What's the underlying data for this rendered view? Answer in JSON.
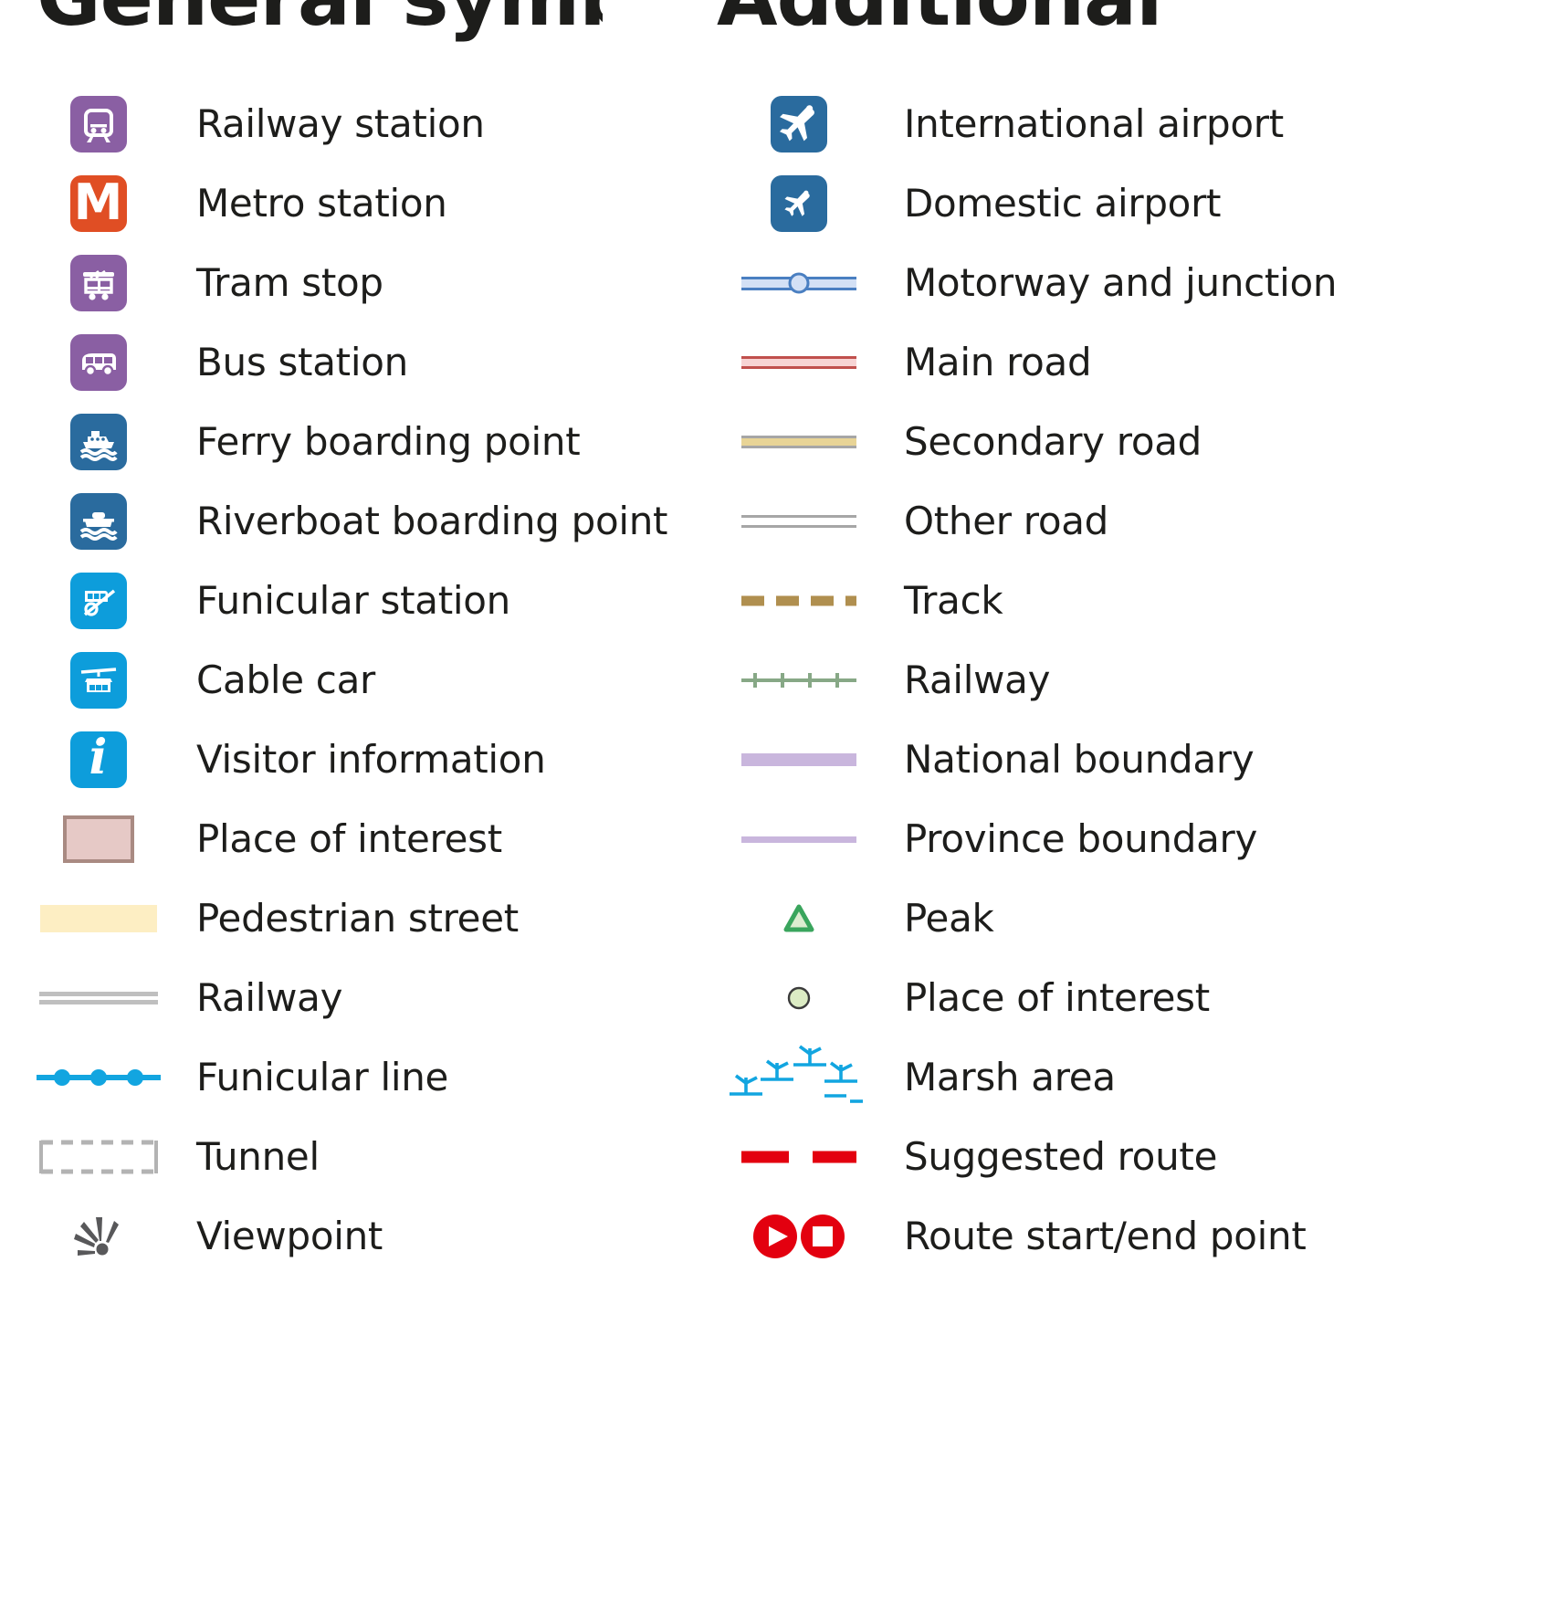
{
  "headings": {
    "left": "General symbols",
    "right": "Additional data"
  },
  "colors": {
    "purple": "#8a5fa3",
    "metro_orange": "#e04e24",
    "navy_blue": "#2a6b9e",
    "cyan_blue": "#0d9ddb",
    "poi_fill": "#e6c9c6",
    "poi_border": "#a98a82",
    "pedestrian": "#fdeec3",
    "railway_grey": "#bfbfbf",
    "viewpoint_grey": "#58585a",
    "motorway_fill": "#d3e0f5",
    "motorway_border": "#4a7fc1",
    "main_road_fill": "#f7d4d4",
    "main_road_border": "#c0504d",
    "secondary_fill": "#e8d496",
    "secondary_border": "#a6a6a6",
    "other_road_fill": "#ffffff",
    "other_road_border": "#a6a6a6",
    "track": "#b08f4f",
    "railway_green": "#87a886",
    "boundary_purple": "#c9b6dd",
    "peak_green": "#3aa55d",
    "peak_fill": "#dcecd0",
    "poi_circle_fill": "#dcecc4",
    "poi_circle_border": "#3b3b3b",
    "marsh_blue": "#12a5e0",
    "route_red": "#e3000f"
  },
  "left_column": [
    {
      "label": "Railway station",
      "icon": "railway-station-icon"
    },
    {
      "label": "Metro station",
      "icon": "metro-station-icon",
      "glyph": "M"
    },
    {
      "label": "Tram stop",
      "icon": "tram-stop-icon"
    },
    {
      "label": "Bus station",
      "icon": "bus-station-icon"
    },
    {
      "label": "Ferry boarding point",
      "icon": "ferry-boarding-icon"
    },
    {
      "label": "Riverboat boarding point",
      "icon": "riverboat-boarding-icon"
    },
    {
      "label": "Funicular station",
      "icon": "funicular-station-icon"
    },
    {
      "label": "Cable car",
      "icon": "cable-car-icon"
    },
    {
      "label": "Visitor information",
      "icon": "visitor-information-icon",
      "glyph": "i"
    },
    {
      "label": "Place of interest",
      "icon": "place-of-interest-area-icon"
    },
    {
      "label": "Pedestrian street",
      "icon": "pedestrian-street-icon"
    },
    {
      "label": "Railway",
      "icon": "railway-line-icon"
    },
    {
      "label": "Funicular line",
      "icon": "funicular-line-icon"
    },
    {
      "label": "Tunnel",
      "icon": "tunnel-icon"
    },
    {
      "label": "Viewpoint",
      "icon": "viewpoint-icon"
    }
  ],
  "right_column": [
    {
      "label": "International airport",
      "icon": "international-airport-icon"
    },
    {
      "label": "Domestic airport",
      "icon": "domestic-airport-icon"
    },
    {
      "label": "Motorway and junction",
      "icon": "motorway-junction-icon"
    },
    {
      "label": "Main road",
      "icon": "main-road-icon"
    },
    {
      "label": "Secondary road",
      "icon": "secondary-road-icon"
    },
    {
      "label": "Other road",
      "icon": "other-road-icon"
    },
    {
      "label": "Track",
      "icon": "track-icon"
    },
    {
      "label": "Railway",
      "icon": "railway-green-icon"
    },
    {
      "label": "National boundary",
      "icon": "national-boundary-icon"
    },
    {
      "label": "Province boundary",
      "icon": "province-boundary-icon"
    },
    {
      "label": "Peak",
      "icon": "peak-icon"
    },
    {
      "label": "Place of interest",
      "icon": "place-of-interest-point-icon"
    },
    {
      "label": "Marsh area",
      "icon": "marsh-area-icon"
    },
    {
      "label": "Suggested route",
      "icon": "suggested-route-icon"
    },
    {
      "label": "Route start/end point",
      "icon": "route-start-end-icon"
    }
  ]
}
